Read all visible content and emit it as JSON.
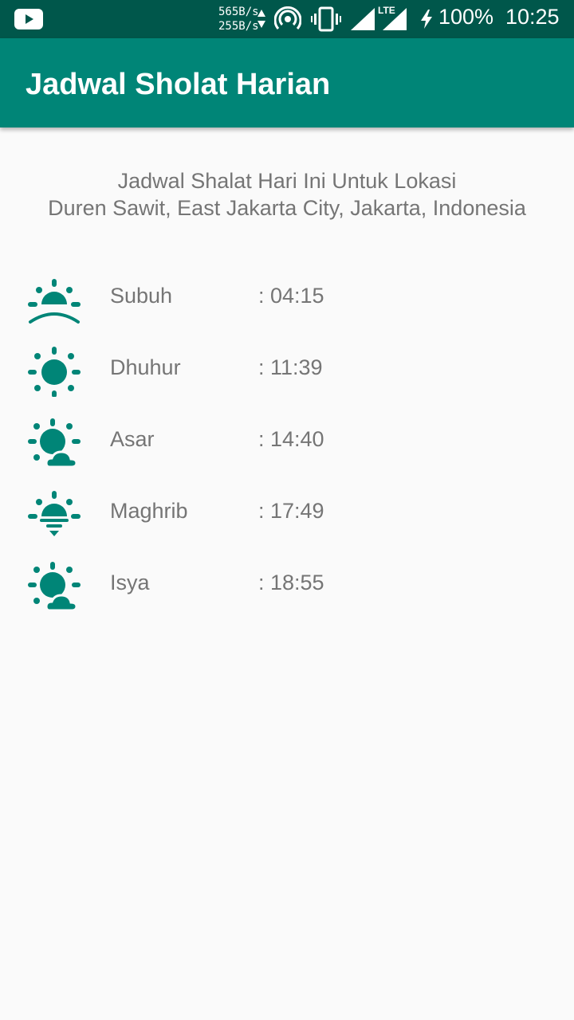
{
  "status_bar": {
    "speed_up": "565B/s",
    "speed_down": "255B/s",
    "network": "LTE",
    "battery": "100%",
    "time": "10:25",
    "icons": [
      "youtube-icon",
      "data-arrows-icon",
      "hotspot-icon",
      "vibrate-icon",
      "signal-icon",
      "lte-signal-icon",
      "charging-icon"
    ]
  },
  "app_bar": {
    "title": "Jadwal Sholat Harian"
  },
  "header": {
    "line1": "Jadwal Shalat Hari Ini Untuk Lokasi",
    "line2": "Duren Sawit, East Jakarta City, Jakarta, Indonesia"
  },
  "prayers": [
    {
      "name": "Subuh",
      "time": ": 04:15",
      "icon": "sunrise-icon"
    },
    {
      "name": "Dhuhur",
      "time": ": 11:39",
      "icon": "sun-icon"
    },
    {
      "name": "Asar",
      "time": ": 14:40",
      "icon": "sun-cloud-icon"
    },
    {
      "name": "Maghrib",
      "time": ": 17:49",
      "icon": "sunset-icon"
    },
    {
      "name": "Isya",
      "time": ": 18:55",
      "icon": "sun-cloud-icon"
    }
  ],
  "colors": {
    "primary": "#008577",
    "primary_dark": "#00574b",
    "text": "#757575",
    "background": "#fafafa"
  }
}
